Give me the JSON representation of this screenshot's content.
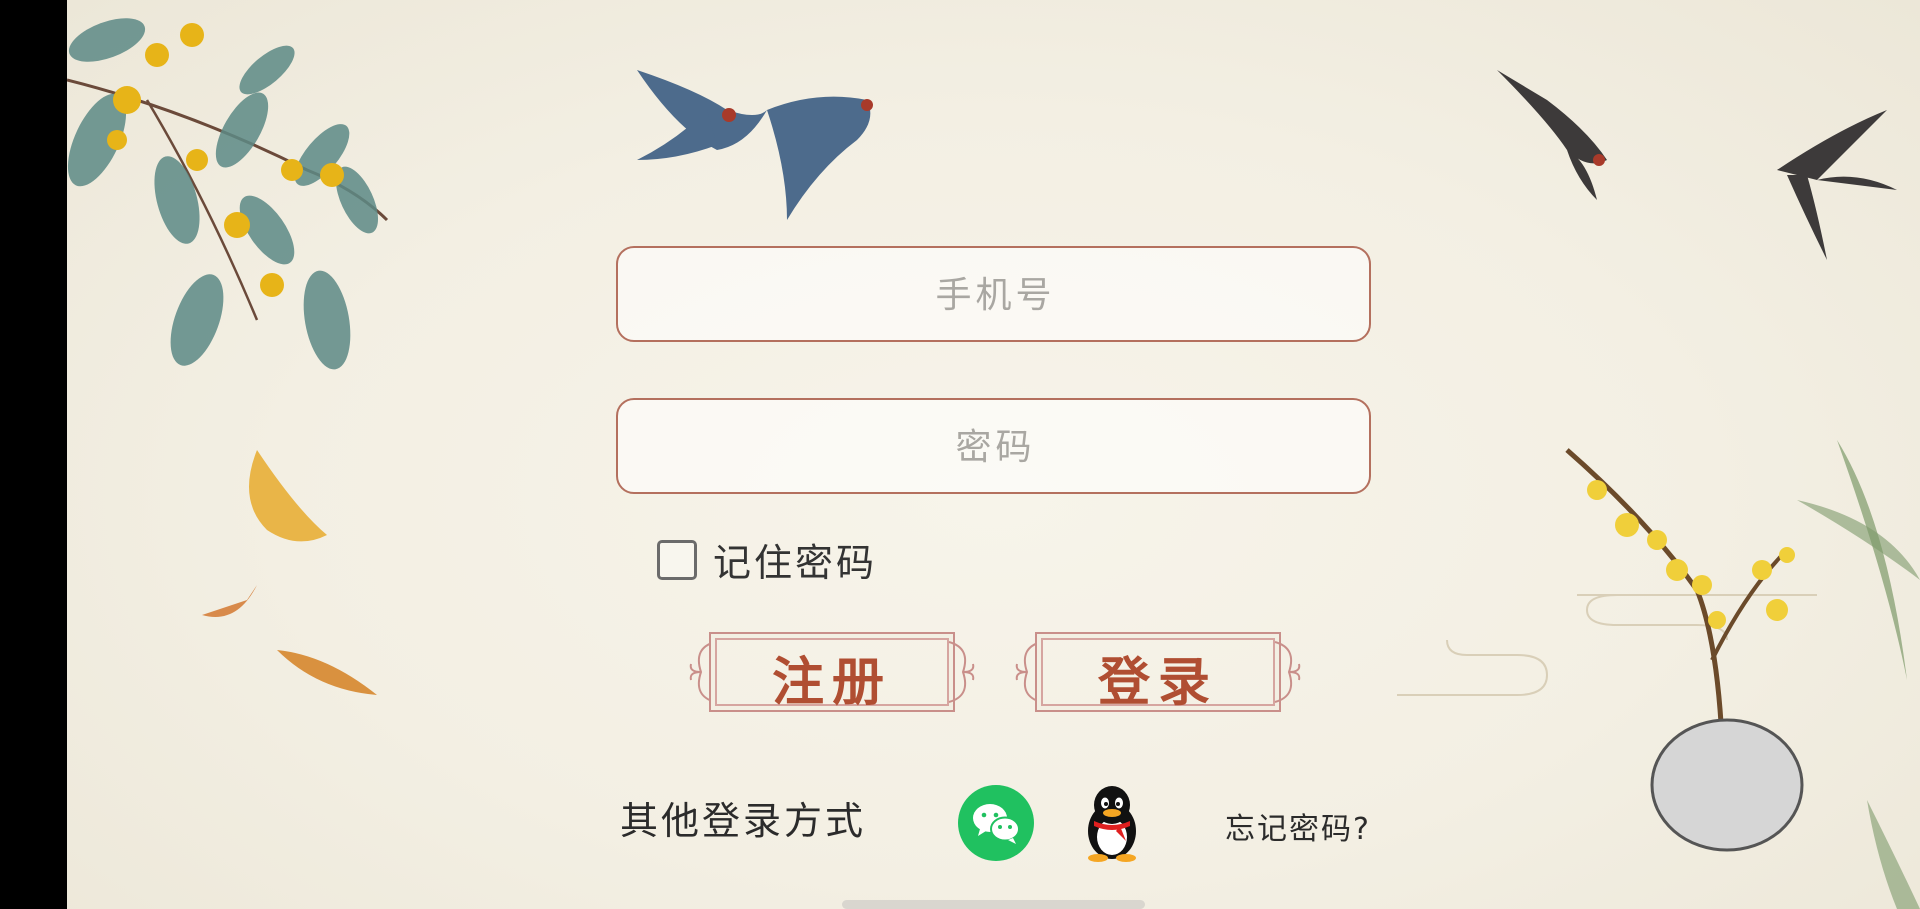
{
  "login": {
    "phone_placeholder": "手机号",
    "password_placeholder": "密码",
    "remember_label": "记住密码",
    "register_label": "注册",
    "login_label": "登录",
    "other_login_label": "其他登录方式",
    "forgot_label": "忘记密码?"
  },
  "icons": {
    "wechat": "wechat-icon",
    "qq": "qq-icon"
  },
  "colors": {
    "accent": "#b04e32",
    "field_border": "#b4705e",
    "wechat_green": "#20c160"
  }
}
